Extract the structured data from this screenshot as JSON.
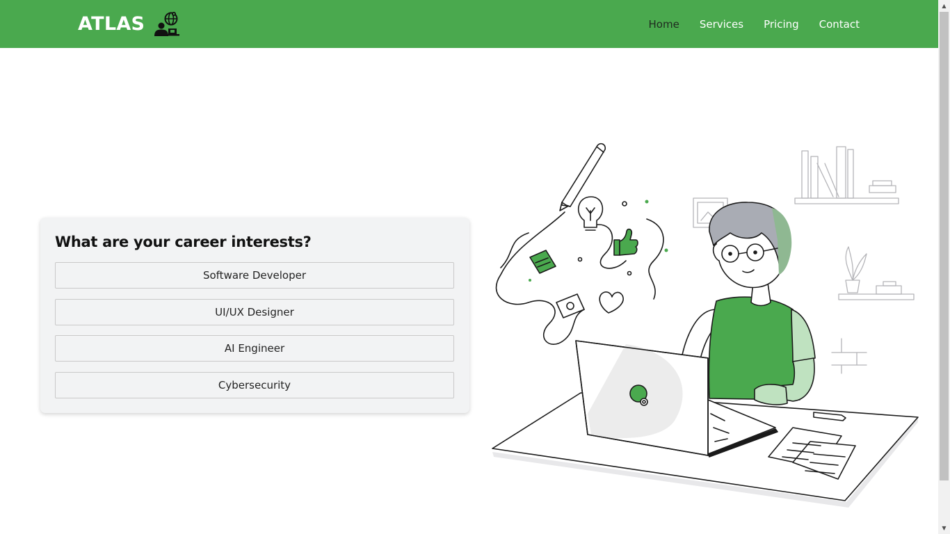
{
  "header": {
    "brand": "ATLAS",
    "brand_icon": "globe-with-person-icon",
    "nav": [
      {
        "label": "Home",
        "active": true
      },
      {
        "label": "Services",
        "active": false
      },
      {
        "label": "Pricing",
        "active": false
      },
      {
        "label": "Contact",
        "active": false
      }
    ]
  },
  "card": {
    "title": "What are your career interests?",
    "options": [
      {
        "label": "Software Developer"
      },
      {
        "label": "UI/UX Designer"
      },
      {
        "label": "AI Engineer"
      },
      {
        "label": "Cybersecurity"
      }
    ]
  },
  "illustration": {
    "icon": "person-working-on-laptop-illustration"
  },
  "colors": {
    "accent": "#4aa94e",
    "card_background": "#f2f3f4",
    "active_nav_text": "#1f2a1f"
  }
}
